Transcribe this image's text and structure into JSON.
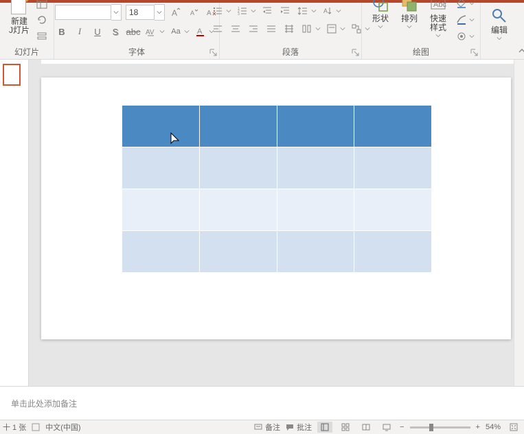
{
  "ribbon": {
    "slides": {
      "new_slide_label": "新建\nJ灯片",
      "group_label": "幻灯片"
    },
    "font": {
      "size_value": "18",
      "group_label": "字体"
    },
    "paragraph": {
      "group_label": "段落"
    },
    "drawing": {
      "shapes_label": "形状",
      "arrange_label": "排列",
      "quick_styles_label": "快速样式",
      "group_label": "绘图"
    },
    "editing": {
      "edit_label": "编辑"
    }
  },
  "notes_placeholder": "单击此处添加备注",
  "status": {
    "slide_counter": "十 1 张",
    "language": "中文(中国)",
    "notes_btn": "备注",
    "comments_btn": "批注",
    "zoom_pct": "54%"
  },
  "chart_data": {
    "type": "table",
    "rows": 4,
    "cols": 4,
    "header_present": true,
    "cells": [
      [
        "",
        "",
        "",
        ""
      ],
      [
        "",
        "",
        "",
        ""
      ],
      [
        "",
        "",
        "",
        ""
      ],
      [
        "",
        "",
        "",
        ""
      ]
    ]
  }
}
